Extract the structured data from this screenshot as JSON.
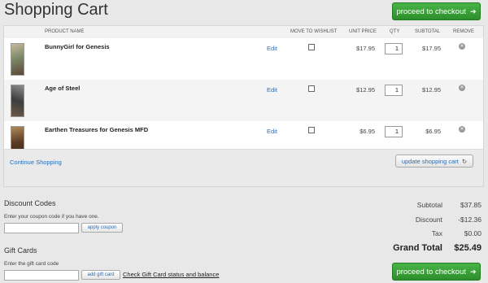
{
  "page_title": "Shopping Cart",
  "checkout_label": "proceed to checkout",
  "columns": {
    "product": "PRODUCT NAME",
    "wishlist": "MOVE TO WISHLIST",
    "unit_price": "UNIT PRICE",
    "qty": "QTY",
    "subtotal": "SUBTOTAL",
    "remove": "REMOVE"
  },
  "items": [
    {
      "name": "BunnyGirl for Genesis",
      "edit": "Edit",
      "unit_price": "$17.95",
      "qty": "1",
      "subtotal": "$17.95"
    },
    {
      "name": "Age of Steel",
      "edit": "Edit",
      "unit_price": "$12.95",
      "qty": "1",
      "subtotal": "$12.95"
    },
    {
      "name": "Earthen Treasures for Genesis MFD",
      "edit": "Edit",
      "unit_price": "$6.95",
      "qty": "1",
      "subtotal": "$6.95"
    }
  ],
  "continue_label": "Continue Shopping",
  "update_label": "update shopping cart",
  "discount": {
    "title": "Discount Codes",
    "hint": "Enter your coupon code if you have one.",
    "apply_label": "apply coupon"
  },
  "giftcard": {
    "title": "Gift Cards",
    "hint": "Enter the gift card code",
    "add_label": "add gift card",
    "check_link": "Check Gift Card status and balance"
  },
  "totals": {
    "subtotal_label": "Subtotal",
    "subtotal": "$37.85",
    "discount_label": "Discount",
    "discount": "-$12.36",
    "tax_label": "Tax",
    "tax": "$0.00",
    "grand_label": "Grand Total",
    "grand": "$25.49"
  },
  "colors": {
    "accent_green": "#3aa238",
    "link_blue": "#2a6cb5"
  }
}
